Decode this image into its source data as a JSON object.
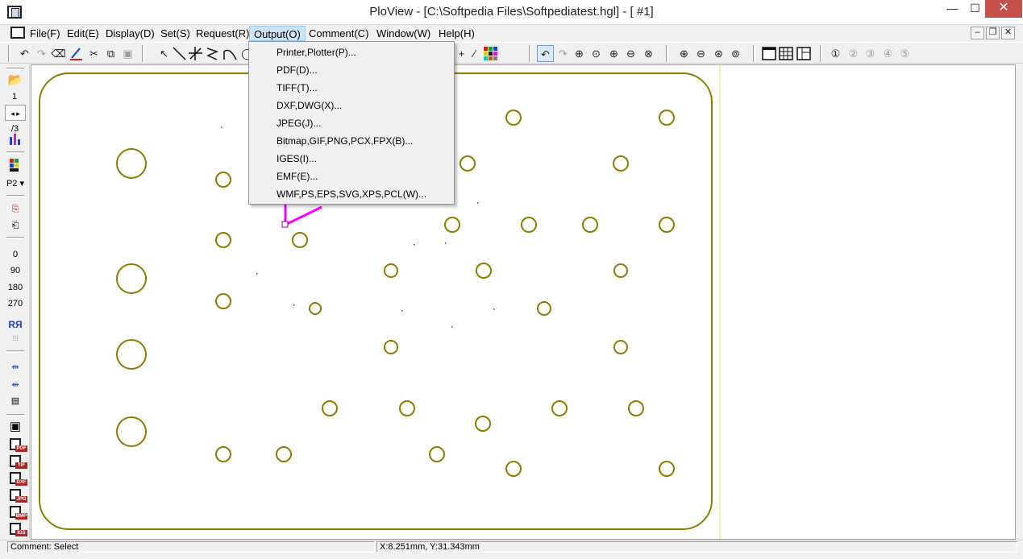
{
  "window": {
    "title": "PloView - [C:\\Softpedia Files\\Softpediatest.hgl] - [ #1]",
    "minimize": "—",
    "maximize": "☐",
    "close": "✕"
  },
  "menubar": {
    "items": [
      "File(F)",
      "Edit(E)",
      "Display(D)",
      "Set(S)",
      "Request(R)",
      "Output(O)",
      "Comment(C)",
      "Window(W)",
      "Help(H)"
    ],
    "active": "Output(O)",
    "mdi_min": "–",
    "mdi_restore": "❐",
    "mdi_close": "✕"
  },
  "output_menu": {
    "items": [
      "Printer,Plotter(P)...",
      "PDF(D)...",
      "TIFF(T)...",
      "DXF,DWG(X)...",
      "JPEG(J)...",
      "Bitmap,GIF,PNG,PCX,FPX(B)...",
      "IGES(I)...",
      "EMF(E)...",
      "WMF,PS,EPS,SVG,XPS,PCL(W)..."
    ]
  },
  "left_toolbar": {
    "page_current": "1",
    "page_total": "/3",
    "pen_select": "P2 ▾",
    "rotations": [
      "0",
      "90",
      "180",
      "270"
    ],
    "mirror_label": "RЯ",
    "save_formats": [
      "PDF",
      "TIF",
      "DXF",
      "JPG",
      "BMP",
      "IGS"
    ]
  },
  "toolbar": {
    "icons": [
      "undo-icon",
      "redo-icon",
      "erase-icon",
      "pen-icon",
      "cut-icon",
      "copy-icon",
      "paste-icon",
      "select-arrow-icon",
      "line-icon",
      "cross-icon",
      "polyline-icon",
      "arc-icon",
      "grid-icon",
      "zoom-in-icon",
      "zoom-out-icon",
      "window-icon",
      "table-icon",
      "layout-icon"
    ]
  },
  "status": {
    "comment": "Comment: Select",
    "coordinates": "X:8.251mm, Y:31.343mm"
  },
  "colors": {
    "drawing_stroke": "#8b7d00",
    "selection": "#ff00ff",
    "menu_highlight": "#cce4f7",
    "close_button": "#c7504a"
  },
  "drawing": {
    "units": "mm"
  }
}
